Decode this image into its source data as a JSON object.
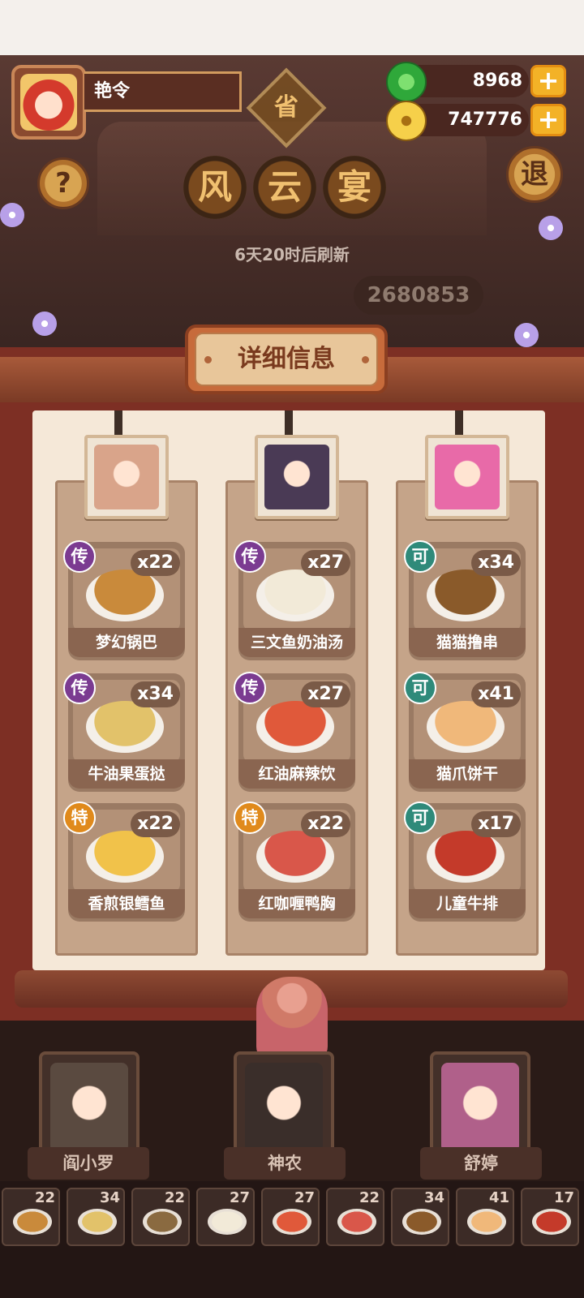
{
  "player": {
    "name": "艳令"
  },
  "currencies": [
    {
      "name": "jade",
      "value": "8968",
      "color": "#2fa83a"
    },
    {
      "name": "coin",
      "value": "747776",
      "color": "#e8b52c"
    }
  ],
  "header": {
    "province_label": "省",
    "help_label": "?",
    "exit_label": "退",
    "title_chars": [
      "风",
      "云",
      "宴"
    ],
    "refresh_text": "6天20时后刷新",
    "score_text": "2680853"
  },
  "panel": {
    "title": "详细信息",
    "columns": [
      {
        "portrait_color": "#d9a48a",
        "dishes": [
          {
            "rarity": "传",
            "rarity_color": "#7b3b91",
            "count": "x22",
            "name": "梦幻锅巴",
            "color": "#c98a3b"
          },
          {
            "rarity": "传",
            "rarity_color": "#7b3b91",
            "count": "x34",
            "name": "牛油果蛋挞",
            "color": "#e2c26a"
          },
          {
            "rarity": "特",
            "rarity_color": "#e08a1c",
            "count": "x22",
            "name": "香煎银鳕鱼",
            "color": "#f1c24a"
          }
        ]
      },
      {
        "portrait_color": "#4a3a55",
        "dishes": [
          {
            "rarity": "传",
            "rarity_color": "#7b3b91",
            "count": "x27",
            "name": "三文鱼奶油汤",
            "color": "#f2ead8"
          },
          {
            "rarity": "传",
            "rarity_color": "#7b3b91",
            "count": "x27",
            "name": "红油麻辣饮",
            "color": "#e0593a"
          },
          {
            "rarity": "特",
            "rarity_color": "#e08a1c",
            "count": "x22",
            "name": "红咖喱鸭胸",
            "color": "#d9574a"
          }
        ]
      },
      {
        "portrait_color": "#e86aa8",
        "dishes": [
          {
            "rarity": "可",
            "rarity_color": "#2f8a7a",
            "count": "x34",
            "name": "猫猫撸串",
            "color": "#8a5a2a"
          },
          {
            "rarity": "可",
            "rarity_color": "#2f8a7a",
            "count": "x41",
            "name": "猫爪饼干",
            "color": "#f0b87a"
          },
          {
            "rarity": "可",
            "rarity_color": "#2f8a7a",
            "count": "x17",
            "name": "儿童牛排",
            "color": "#c43a2a"
          }
        ]
      }
    ]
  },
  "characters": [
    {
      "name": "阎小罗",
      "color": "#5a4a40"
    },
    {
      "name": "神农",
      "color": "#3a2e2a"
    },
    {
      "name": "舒婷",
      "color": "#b0608a"
    }
  ],
  "inventory": [
    {
      "count": "22",
      "color": "#c98a3b"
    },
    {
      "count": "34",
      "color": "#e2c26a"
    },
    {
      "count": "22",
      "color": "#8a6a40"
    },
    {
      "count": "27",
      "color": "#f2ead8"
    },
    {
      "count": "27",
      "color": "#e0593a"
    },
    {
      "count": "22",
      "color": "#d9574a"
    },
    {
      "count": "34",
      "color": "#8a5a2a"
    },
    {
      "count": "41",
      "color": "#f0b87a"
    },
    {
      "count": "17",
      "color": "#c43a2a"
    }
  ]
}
